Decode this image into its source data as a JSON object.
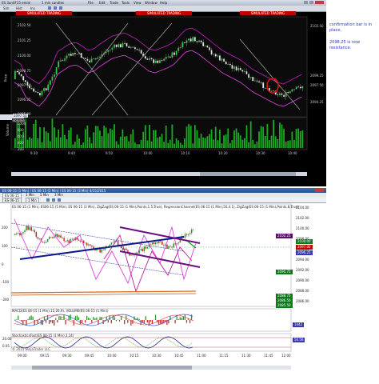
{
  "top_window": {
    "title": "ES 3un0F15 emini",
    "interval": "1 min candles",
    "menu": [
      "File",
      "Edit",
      "Trade",
      "Tools",
      "View",
      "Window",
      "Help"
    ],
    "toolbar": [
      "Sim",
      "Hist",
      "Ins"
    ],
    "banners": [
      "SIMULATED TRADING",
      "SIMULATED TRADING",
      "SIMULATED TRADING"
    ],
    "price_axis_title": "Price",
    "price_ticks": [
      "2102.50",
      "2101.25",
      "2100.00",
      "2098.75",
      "2097.50",
      "2096.25",
      "2095.00"
    ],
    "price_tags": [
      {
        "text": "2102.50",
        "color": "#333333"
      },
      {
        "text": "2099.25",
        "color": "#333333"
      },
      {
        "text": "2097.50",
        "color": "#333333"
      },
      {
        "text": "2094.25",
        "color": "#333333"
      }
    ],
    "volume_label": "Volume",
    "volume_ticks": [
      "1000",
      "800",
      "600",
      "400",
      "200"
    ],
    "time_ticks": [
      "9:30",
      "9:40",
      "9:50",
      "10:00",
      "10:10",
      "10:20",
      "10:30",
      "10:40"
    ]
  },
  "bottom_window": {
    "title": "ES 06-15 (1 Min) / ES 06-15 (5 Min) / ES 06-15 (3 Min) 4/15/2015",
    "tabs": [
      "ES 06-15",
      "1 Min",
      "5 Min",
      "3 Min"
    ],
    "indicator_line": "ES 06-15 (1 Min), ES06-15 (5 Min), ES 06-15 (3 Min), ZigZag(ES 06-15 (1 Min),Points,1.5,True), RegressionChannel(ES 06-15 (1 Min),50,4.1), ZigZag(ES 06-15 (1 Min),Points,8,True)",
    "left_ticks": [
      "200",
      "100",
      "0",
      "-100",
      "-200"
    ],
    "right_ticks": [
      "2104.00",
      "2102.00",
      "2100.00",
      "2098.00",
      "2096.00",
      "2094.00",
      "2092.00",
      "2090.00",
      "2088.00",
      "2086.00"
    ],
    "right_tags": [
      {
        "text": "2102.25",
        "color": "#5a0e6b"
      },
      {
        "text": "2100.00",
        "color": "#0c7a1c"
      },
      {
        "text": "2097.00",
        "color": "#c00000"
      },
      {
        "text": "2096.25",
        "color": "#3a3ab0"
      },
      {
        "text": "2090.75",
        "color": "#0c7a1c"
      },
      {
        "text": "2088.75",
        "color": "#0c7a1c"
      },
      {
        "text": "2086.50",
        "color": "#0c7a1c"
      },
      {
        "text": "2085.50",
        "color": "#0c7a1c"
      }
    ],
    "time_ticks": [
      "09:00",
      "09:15",
      "09:30",
      "09:45",
      "10:00",
      "10:15",
      "10:30",
      "10:45",
      "11:00",
      "11:15",
      "11:30",
      "11:45",
      "12:00"
    ],
    "osc_label": "MACD(ES 06-15 (1 Min),12,26,9), VOLUME(ES 06-15 (1 Min))",
    "osc2_label": "StochasticsFast(ES 06-15 (1 Min),3,14)",
    "copyright": "© 2015 NinjaTrader LLC",
    "panel_values": [
      "1442",
      "50.56",
      "20.00",
      "0.05"
    ]
  },
  "notes": {
    "line1": "confirmation bar is in place.",
    "line2": "2098.25 is now resistance."
  }
}
